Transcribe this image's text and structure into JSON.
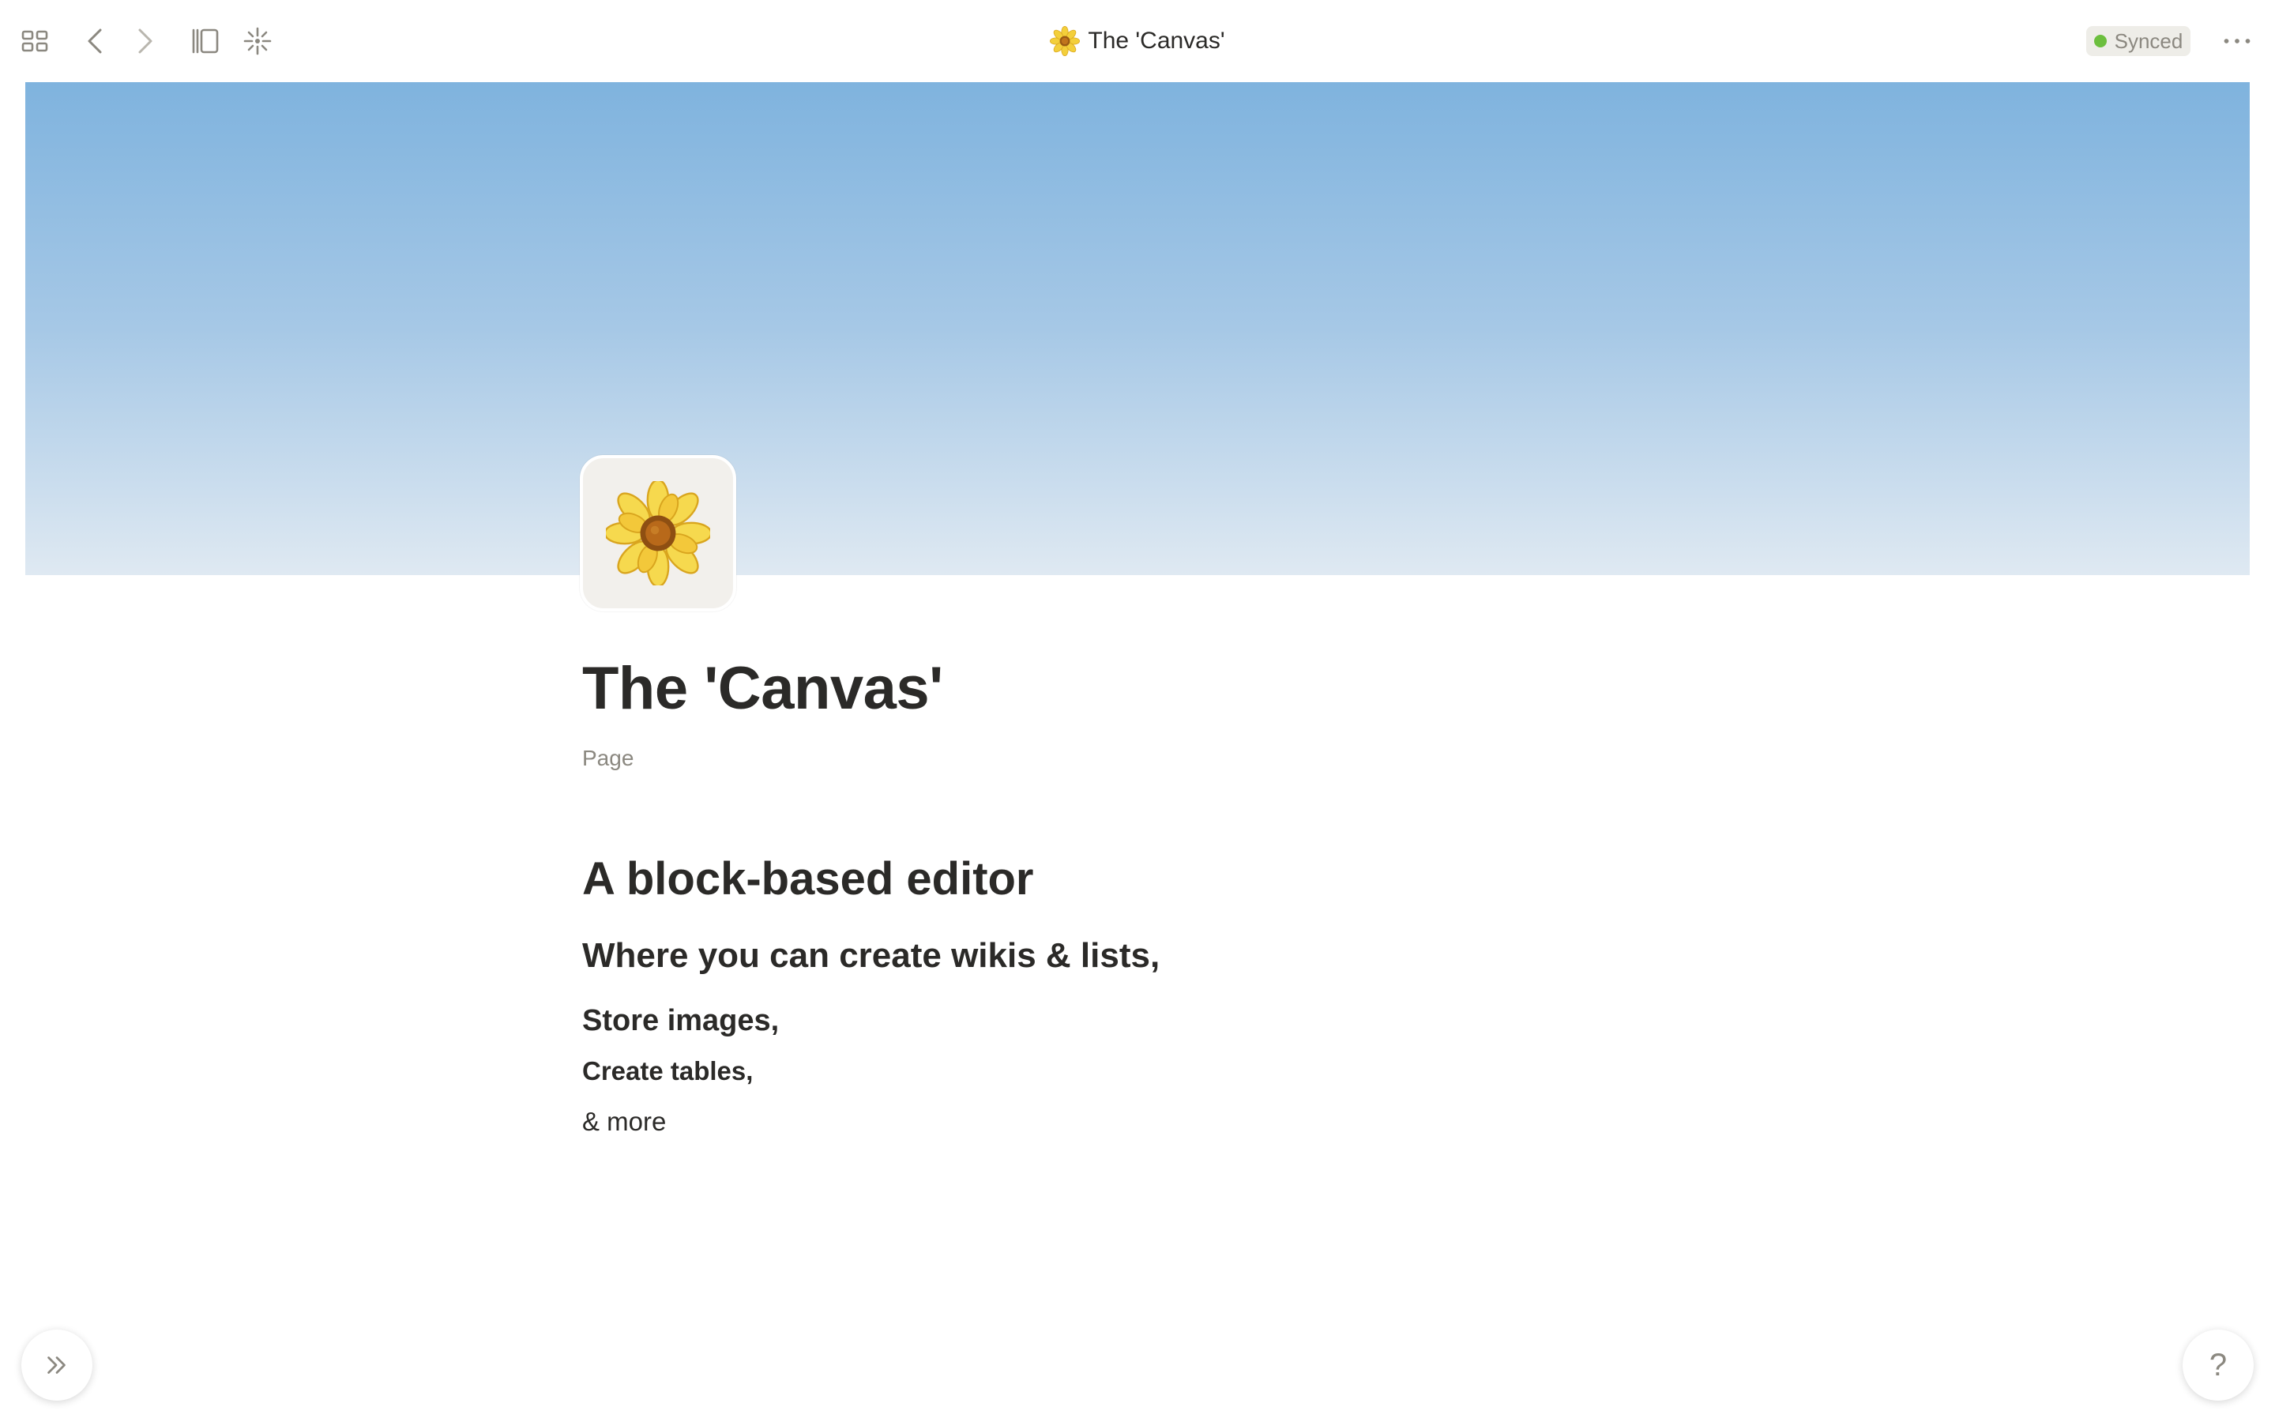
{
  "topbar": {
    "title": "The 'Canvas'",
    "status": "Synced",
    "icons": [
      "grid-icon",
      "back-arrow-icon",
      "forward-arrow-icon",
      "sidebar-toggle-icon",
      "sparkle-icon",
      "more-icon"
    ]
  },
  "page": {
    "icon": "sunflower-icon",
    "title": "The 'Canvas'",
    "type_label": "Page"
  },
  "blocks": {
    "heading1": "A block-based editor",
    "heading2": "Where you can create wikis & lists,",
    "heading3": "Store images,",
    "heading4": "Create tables,",
    "paragraph": "& more"
  },
  "floating": {
    "help_label": "?"
  },
  "colors": {
    "accent_status": "#6cbf3e",
    "cover_top": "#7fb3de",
    "cover_bottom": "#dfe9f2",
    "text": "#2b2a28",
    "muted": "#8b8880"
  }
}
